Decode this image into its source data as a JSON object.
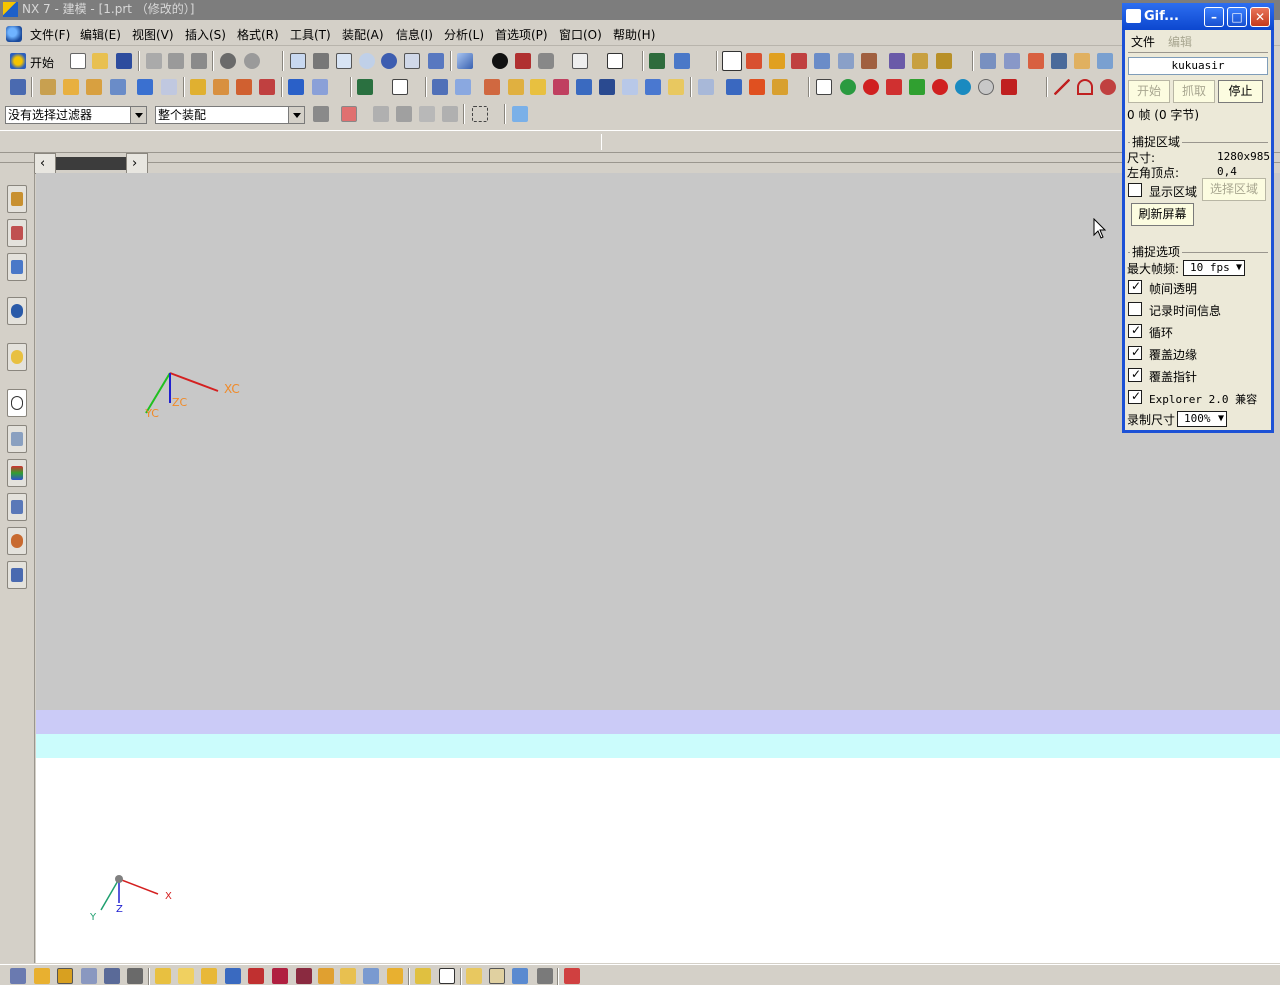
{
  "window": {
    "title": "NX 7 - 建模 - [1.prt （修改的）]"
  },
  "menubar": {
    "items": [
      "文件(F)",
      "编辑(E)",
      "视图(V)",
      "插入(S)",
      "格式(R)",
      "工具(T)",
      "装配(A)",
      "信息(I)",
      "分析(L)",
      "首选项(P)",
      "窗口(O)",
      "帮助(H)"
    ]
  },
  "toolbar": {
    "start_label": "开始"
  },
  "selection_bar": {
    "filter_value": "没有选择过滤器",
    "scope_value": "整个装配"
  },
  "viewport": {
    "wcs_labels": {
      "xc": "XC",
      "yc": "YC",
      "zc": "ZC"
    },
    "abs_labels": {
      "x": "X",
      "y": "Y",
      "z": "Z"
    },
    "colors": {
      "background": "#c8c8c8",
      "band_violet": "#cbcbf7",
      "band_cyan": "#cbfcfc"
    }
  },
  "gifcam": {
    "title": "Gif...",
    "menu": [
      "文件",
      "编辑"
    ],
    "user_field": "kukuasir",
    "buttons": {
      "start": "开始",
      "capture": "抓取",
      "stop": "停止"
    },
    "frames_text": "0 帧 (0 字节)",
    "capture_region": {
      "group_label": "捕捉区域",
      "size_label": "尺寸:",
      "size_value": "1280x985",
      "corner_label": "左角顶点:",
      "corner_value": "0,4",
      "show_region_label": "显示区域",
      "show_region_checked": false,
      "select_region_button": "选择区域",
      "refresh_button": "刷新屏幕"
    },
    "capture_options": {
      "group_label": "捕捉选项",
      "max_fps_label": "最大帧频:",
      "max_fps_value": "10 fps",
      "options": [
        {
          "label": "帧间透明",
          "checked": true
        },
        {
          "label": "记录时间信息",
          "checked": false
        },
        {
          "label": "循环",
          "checked": true
        },
        {
          "label": "覆盖边缘",
          "checked": true
        },
        {
          "label": "覆盖指针",
          "checked": true
        },
        {
          "label": "Explorer 2.0 兼容",
          "checked": true
        }
      ],
      "record_size_label": "录制尺寸",
      "record_size_value": "100%"
    }
  }
}
